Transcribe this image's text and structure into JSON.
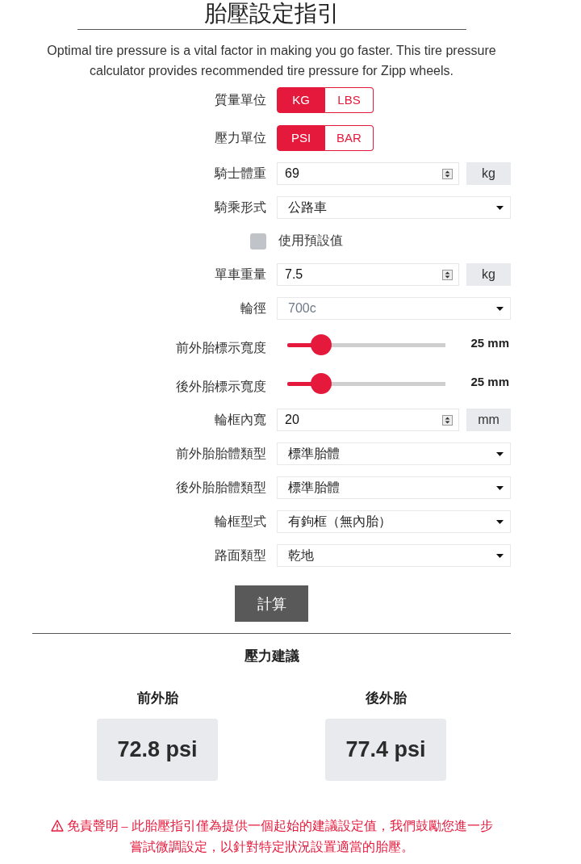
{
  "title": "胎壓設定指引",
  "intro": "Optimal tire pressure is a vital factor in making you go faster. This tire pressure calculator provides recommended tire pressure for Zipp wheels.",
  "settings": [
    {
      "kind": "toggle",
      "label": "質量單位",
      "options": [
        {
          "label": "KG",
          "selected": true
        },
        {
          "label": "LBS",
          "selected": false
        }
      ]
    },
    {
      "kind": "toggle",
      "label": "壓力單位",
      "options": [
        {
          "label": "PSI",
          "selected": true
        },
        {
          "label": "BAR",
          "selected": false
        }
      ]
    },
    {
      "kind": "number",
      "label": "騎士體重",
      "value": "69",
      "unit": "kg"
    },
    {
      "kind": "select",
      "label": "騎乘形式",
      "value": "公路車",
      "disabled": false
    },
    {
      "kind": "checkbox",
      "label": "使用預設值",
      "checked": false
    },
    {
      "kind": "number",
      "label": "單車重量",
      "value": "7.5",
      "unit": "kg"
    },
    {
      "kind": "select",
      "label": "輪徑",
      "value": "700c",
      "disabled": true
    },
    {
      "kind": "slider",
      "label": "前外胎標示寬度",
      "level": 0.17,
      "reading": "25 mm"
    },
    {
      "kind": "slider",
      "label": "後外胎標示寬度",
      "level": 0.17,
      "reading": "25 mm"
    },
    {
      "kind": "number",
      "label": "輪框內寬",
      "value": "20",
      "unit": "mm"
    },
    {
      "kind": "select",
      "label": "前外胎胎體類型",
      "value": "標準胎體",
      "disabled": false
    },
    {
      "kind": "select",
      "label": "後外胎胎體類型",
      "value": "標準胎體",
      "disabled": false
    },
    {
      "kind": "select",
      "label": "輪框型式",
      "value": "有鉤框（無內胎）",
      "disabled": false
    },
    {
      "kind": "select",
      "label": "路面類型",
      "value": "乾地",
      "disabled": false
    }
  ],
  "calculate_button": "計算",
  "results": {
    "title": "壓力建議",
    "items": [
      {
        "label": "前外胎",
        "value": "72.8 psi"
      },
      {
        "label": "後外胎",
        "value": "77.4 psi"
      }
    ]
  },
  "disclaimer": "免責聲明 – 此胎壓指引僅為提供一個起始的建議設定值，我們鼓勵您進一步嘗試微調設定，以針對特定狀況設置適當的胎壓。"
}
